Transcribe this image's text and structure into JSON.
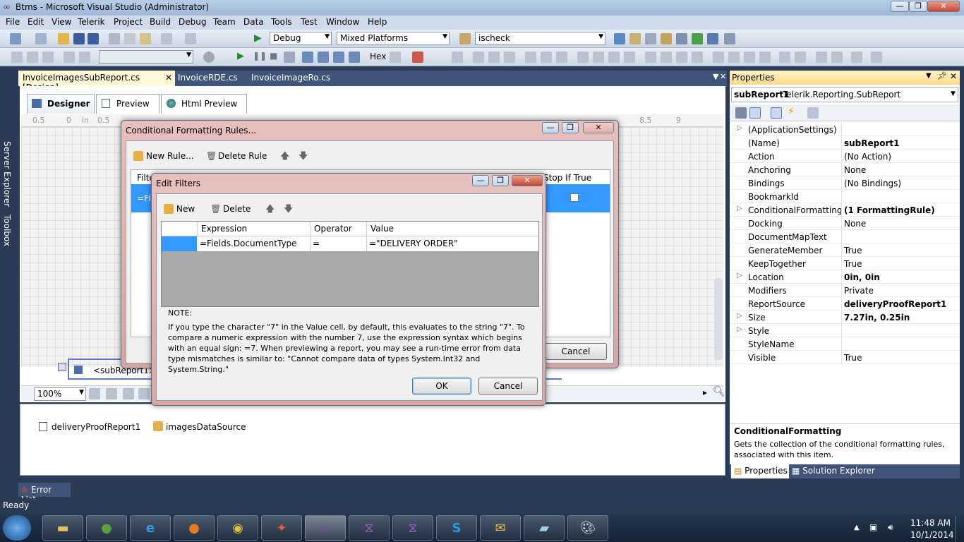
{
  "window": {
    "title": "Btms - Microsoft Visual Studio (Administrator)"
  },
  "menu": [
    "File",
    "Edit",
    "View",
    "Telerik",
    "Project",
    "Build",
    "Debug",
    "Team",
    "Data",
    "Tools",
    "Test",
    "Window",
    "Help"
  ],
  "toolbar": {
    "config": "Debug",
    "platform": "Mixed Platforms",
    "find": "ischeck",
    "hex": "Hex"
  },
  "leftdock": {
    "server_explorer": "Server Explorer",
    "toolbox": "Toolbox"
  },
  "doctabs": [
    {
      "label": "InvoiceImagesSubReport.cs [Design]"
    },
    {
      "label": "InvoiceRDE.cs"
    },
    {
      "label": "InvoiceImageRo.cs"
    }
  ],
  "designer_tabs": {
    "designer": "Designer",
    "preview": "Preview",
    "html_preview": "Html Preview"
  },
  "ruler": [
    "0.5",
    "0",
    "in",
    "0.5",
    "8.5",
    "9"
  ],
  "designer": {
    "subreport_label": "<subReport1>",
    "zoom": "100%"
  },
  "tray": {
    "item1": "deliveryProofReport1",
    "item2": "imagesDataSource"
  },
  "cf_dialog": {
    "title": "Conditional Formatting Rules...",
    "new_rule": "New Rule...",
    "delete_rule": "Delete Rule",
    "col_filters": "Filte",
    "col_stop": "Stop If True",
    "row_value": "=Fi",
    "cancel": "Cancel"
  },
  "ef_dialog": {
    "title": "Edit Filters",
    "new": "New",
    "delete": "Delete",
    "columns": {
      "expression": "Expression",
      "operator": "Operator",
      "value": "Value"
    },
    "row": {
      "expression": "=Fields.DocumentType",
      "operator": "=",
      "value": "=\"DELIVERY ORDER\""
    },
    "note_title": "NOTE:",
    "note_text": "If you type the character \"7\" in the Value cell, by default, this evaluates to the string \"7\". To compare a numeric expression with the number 7, use the expression syntax which begins with an equal sign: =7. When previewing a report, you may see a run-time error from data type mismatches is similar to: \"Cannot compare data of types System.Int32 and System.String.\"",
    "ok": "OK",
    "cancel": "Cancel"
  },
  "properties": {
    "header": "Properties",
    "object": "subReport1",
    "type": "Telerik.Reporting.SubReport",
    "rows": [
      {
        "name": "(ApplicationSettings)",
        "value": "",
        "expandable": true,
        "bold": false
      },
      {
        "name": "(Name)",
        "value": "subReport1",
        "expandable": false,
        "bold": true
      },
      {
        "name": "Action",
        "value": "(No Action)",
        "expandable": false,
        "bold": false
      },
      {
        "name": "Anchoring",
        "value": "None",
        "expandable": false,
        "bold": false
      },
      {
        "name": "Bindings",
        "value": "(No Bindings)",
        "expandable": false,
        "bold": false
      },
      {
        "name": "BookmarkId",
        "value": "",
        "expandable": false,
        "bold": false
      },
      {
        "name": "ConditionalFormatting",
        "value": "(1 FormattingRule)",
        "expandable": true,
        "bold": true
      },
      {
        "name": "Docking",
        "value": "None",
        "expandable": false,
        "bold": false
      },
      {
        "name": "DocumentMapText",
        "value": "",
        "expandable": false,
        "bold": false
      },
      {
        "name": "GenerateMember",
        "value": "True",
        "expandable": false,
        "bold": false
      },
      {
        "name": "KeepTogether",
        "value": "True",
        "expandable": false,
        "bold": false
      },
      {
        "name": "Location",
        "value": "0in, 0in",
        "expandable": true,
        "bold": true
      },
      {
        "name": "Modifiers",
        "value": "Private",
        "expandable": false,
        "bold": false
      },
      {
        "name": "ReportSource",
        "value": "deliveryProofReport1",
        "expandable": false,
        "bold": true
      },
      {
        "name": "Size",
        "value": "7.27in, 0.25in",
        "expandable": true,
        "bold": true
      },
      {
        "name": "Style",
        "value": "",
        "expandable": true,
        "bold": false
      },
      {
        "name": "StyleName",
        "value": "",
        "expandable": false,
        "bold": false
      },
      {
        "name": "Visible",
        "value": "True",
        "expandable": false,
        "bold": false
      }
    ],
    "desc_title": "ConditionalFormatting",
    "desc_text": "Gets the collection of the conditional formatting rules, associated with this item.",
    "tab_props": "Properties",
    "tab_solution": "Solution Explorer"
  },
  "error_list": "Error List",
  "status": "Ready",
  "clock": {
    "time": "11:48 AM",
    "date": "10/1/2014"
  }
}
